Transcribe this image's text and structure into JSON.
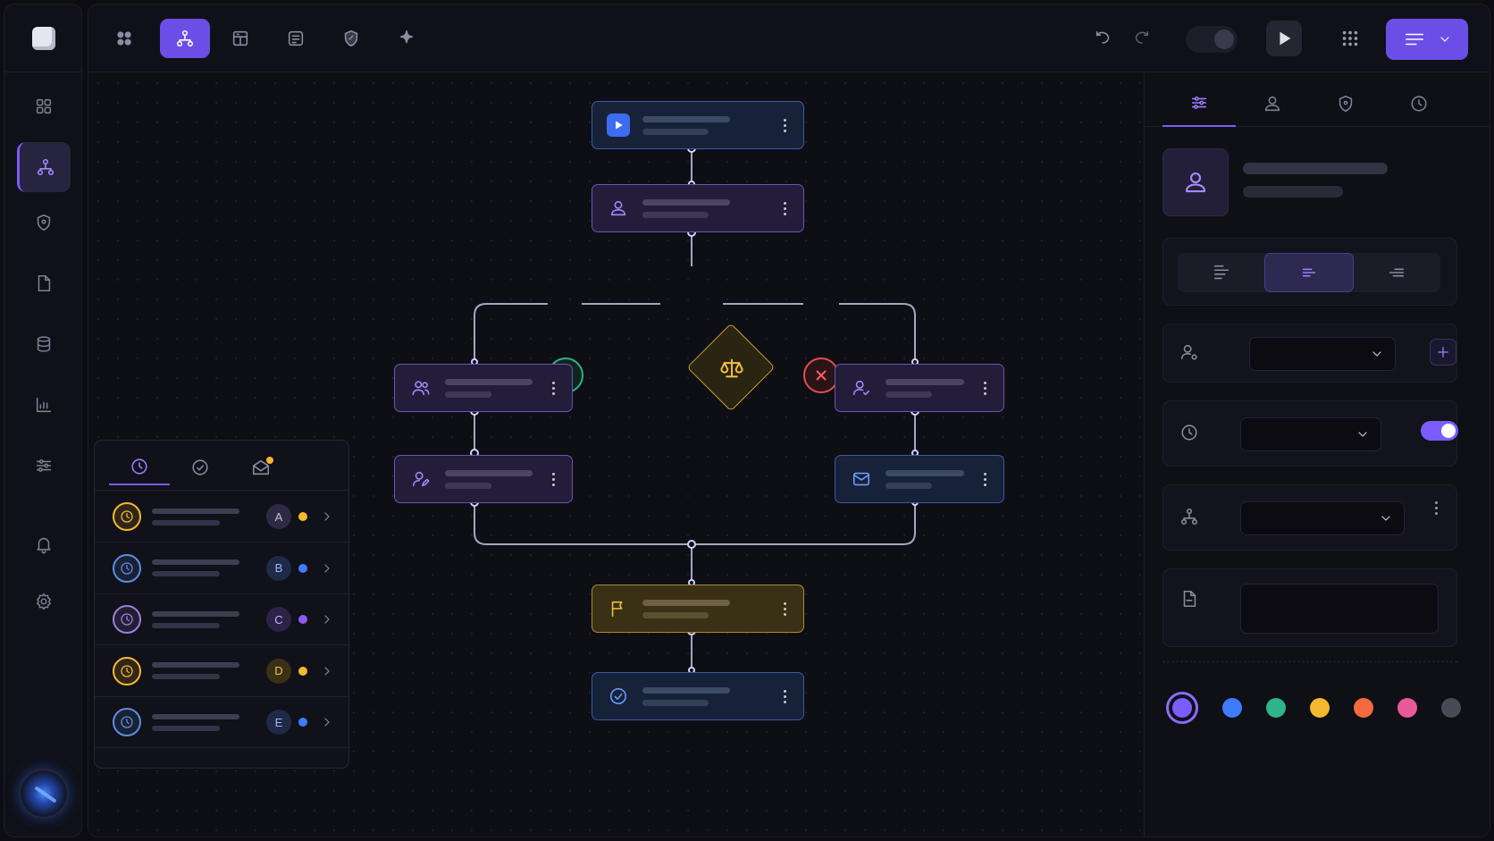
{
  "sidebar": {
    "logo": "app-logo",
    "items": [
      {
        "name": "dashboard",
        "icon": "grid-icon",
        "active": false
      },
      {
        "name": "workflows",
        "icon": "hierarchy-icon",
        "active": true
      },
      {
        "name": "security",
        "icon": "shield-icon",
        "active": false
      },
      {
        "name": "documents",
        "icon": "file-icon",
        "active": false
      },
      {
        "name": "database",
        "icon": "database-icon",
        "active": false
      },
      {
        "name": "analytics",
        "icon": "chart-icon",
        "active": false
      },
      {
        "name": "filters",
        "icon": "sliders-icon",
        "active": false
      },
      {
        "name": "notifications",
        "icon": "bell-icon",
        "active": false
      },
      {
        "name": "settings",
        "icon": "gear-icon",
        "active": false
      }
    ],
    "avatar": "user-avatar"
  },
  "topbar": {
    "tools": [
      {
        "name": "components",
        "icon": "grid-icon",
        "active": false
      },
      {
        "name": "flow",
        "icon": "hierarchy-icon",
        "active": true
      },
      {
        "name": "templates",
        "icon": "layout-icon",
        "active": false
      },
      {
        "name": "forms",
        "icon": "form-icon",
        "active": false
      },
      {
        "name": "rules",
        "icon": "shield-icon",
        "active": false
      },
      {
        "name": "ai",
        "icon": "sparkle-icon",
        "active": false
      }
    ],
    "undo_icon": "undo-icon",
    "redo_icon": "redo-icon",
    "theme_toggle_on": true,
    "run_icon": "play-icon",
    "apps_icon": "apps-grid-icon",
    "menu_icon": "menu-icon"
  },
  "canvas": {
    "nodes": [
      {
        "id": "start",
        "kind": "trigger",
        "icon": "play-icon",
        "color": "#3a5aa8"
      },
      {
        "id": "assign",
        "kind": "user",
        "icon": "user-icon",
        "color": "#6a55b8"
      },
      {
        "id": "team-review",
        "kind": "group",
        "icon": "users-icon",
        "color": "#6a55b8"
      },
      {
        "id": "approver",
        "kind": "user",
        "icon": "user-check-icon",
        "color": "#6a55b8"
      },
      {
        "id": "rework-owner",
        "kind": "user",
        "icon": "user-edit-icon",
        "color": "#6a55b8"
      },
      {
        "id": "notify",
        "kind": "email",
        "icon": "mail-icon",
        "color": "#3a5aa8"
      },
      {
        "id": "milestone",
        "kind": "milestone",
        "icon": "flag-icon",
        "color": "#b08c2a"
      },
      {
        "id": "complete",
        "kind": "end",
        "icon": "check-circle-icon",
        "color": "#3a5aa8"
      }
    ],
    "decision": {
      "icon": "scale-icon",
      "color": "#c9a22e"
    },
    "branch_yes": {
      "icon": "check-icon",
      "color": "#2fb38a"
    },
    "branch_no": {
      "icon": "close-icon",
      "color": "#e0504f"
    }
  },
  "activity_panel": {
    "tabs": [
      {
        "name": "pending",
        "icon": "clock-icon",
        "active": true
      },
      {
        "name": "done",
        "icon": "check-circle-icon",
        "active": false
      },
      {
        "name": "inbox",
        "icon": "mail-open-icon",
        "active": false,
        "has_unread": true
      }
    ],
    "rows": [
      {
        "letter": "A",
        "status_color": "#f5b82e",
        "ring_color": "#f5b82e",
        "letter_bg": "#2e2a44",
        "letter_color": "#c9c2ea"
      },
      {
        "letter": "B",
        "status_color": "#3d7cff",
        "ring_color": "#5a8fe0",
        "letter_bg": "#1f2a48",
        "letter_color": "#9ab8f0"
      },
      {
        "letter": "C",
        "status_color": "#8a5cf0",
        "ring_color": "#9a7ee0",
        "letter_bg": "#2c2448",
        "letter_color": "#c0b0f0"
      },
      {
        "letter": "D",
        "status_color": "#f5b82e",
        "ring_color": "#f5b82e",
        "letter_bg": "#3a3016",
        "letter_color": "#f0c040"
      },
      {
        "letter": "E",
        "status_color": "#3d7cff",
        "ring_color": "#5a8fe0",
        "letter_bg": "#1f2a48",
        "letter_color": "#9ab8f0"
      }
    ]
  },
  "inspector": {
    "tabs": [
      {
        "name": "properties",
        "icon": "sliders-icon",
        "active": true
      },
      {
        "name": "assignee",
        "icon": "user-icon",
        "active": false
      },
      {
        "name": "permissions",
        "icon": "shield-icon",
        "active": false
      },
      {
        "name": "history",
        "icon": "clock-icon",
        "active": false
      }
    ],
    "header_icon": "user-icon",
    "alignment": {
      "options": [
        "left",
        "center",
        "right"
      ],
      "selected": "center"
    },
    "assignee_select": "",
    "schedule_select": "",
    "schedule_enabled": true,
    "route_select": "",
    "notes": "",
    "colors": [
      "#7b5cff",
      "#3d7cff",
      "#2fb38a",
      "#f5b82e",
      "#f26a3d",
      "#e85a9a",
      "#4a4a56"
    ],
    "selected_color": "#7b5cff"
  }
}
